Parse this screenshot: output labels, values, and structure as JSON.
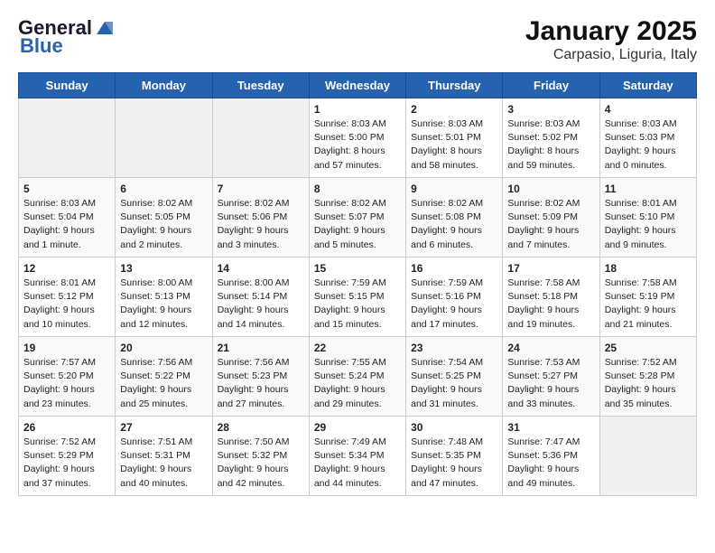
{
  "header": {
    "logo_general": "General",
    "logo_blue": "Blue",
    "title": "January 2025",
    "subtitle": "Carpasio, Liguria, Italy"
  },
  "weekdays": [
    "Sunday",
    "Monday",
    "Tuesday",
    "Wednesday",
    "Thursday",
    "Friday",
    "Saturday"
  ],
  "weeks": [
    [
      {
        "day": "",
        "info": "",
        "empty": true
      },
      {
        "day": "",
        "info": "",
        "empty": true
      },
      {
        "day": "",
        "info": "",
        "empty": true
      },
      {
        "day": "1",
        "info": "Sunrise: 8:03 AM\nSunset: 5:00 PM\nDaylight: 8 hours and 57 minutes.",
        "empty": false
      },
      {
        "day": "2",
        "info": "Sunrise: 8:03 AM\nSunset: 5:01 PM\nDaylight: 8 hours and 58 minutes.",
        "empty": false
      },
      {
        "day": "3",
        "info": "Sunrise: 8:03 AM\nSunset: 5:02 PM\nDaylight: 8 hours and 59 minutes.",
        "empty": false
      },
      {
        "day": "4",
        "info": "Sunrise: 8:03 AM\nSunset: 5:03 PM\nDaylight: 9 hours and 0 minutes.",
        "empty": false
      }
    ],
    [
      {
        "day": "5",
        "info": "Sunrise: 8:03 AM\nSunset: 5:04 PM\nDaylight: 9 hours and 1 minute.",
        "empty": false
      },
      {
        "day": "6",
        "info": "Sunrise: 8:02 AM\nSunset: 5:05 PM\nDaylight: 9 hours and 2 minutes.",
        "empty": false
      },
      {
        "day": "7",
        "info": "Sunrise: 8:02 AM\nSunset: 5:06 PM\nDaylight: 9 hours and 3 minutes.",
        "empty": false
      },
      {
        "day": "8",
        "info": "Sunrise: 8:02 AM\nSunset: 5:07 PM\nDaylight: 9 hours and 5 minutes.",
        "empty": false
      },
      {
        "day": "9",
        "info": "Sunrise: 8:02 AM\nSunset: 5:08 PM\nDaylight: 9 hours and 6 minutes.",
        "empty": false
      },
      {
        "day": "10",
        "info": "Sunrise: 8:02 AM\nSunset: 5:09 PM\nDaylight: 9 hours and 7 minutes.",
        "empty": false
      },
      {
        "day": "11",
        "info": "Sunrise: 8:01 AM\nSunset: 5:10 PM\nDaylight: 9 hours and 9 minutes.",
        "empty": false
      }
    ],
    [
      {
        "day": "12",
        "info": "Sunrise: 8:01 AM\nSunset: 5:12 PM\nDaylight: 9 hours and 10 minutes.",
        "empty": false
      },
      {
        "day": "13",
        "info": "Sunrise: 8:00 AM\nSunset: 5:13 PM\nDaylight: 9 hours and 12 minutes.",
        "empty": false
      },
      {
        "day": "14",
        "info": "Sunrise: 8:00 AM\nSunset: 5:14 PM\nDaylight: 9 hours and 14 minutes.",
        "empty": false
      },
      {
        "day": "15",
        "info": "Sunrise: 7:59 AM\nSunset: 5:15 PM\nDaylight: 9 hours and 15 minutes.",
        "empty": false
      },
      {
        "day": "16",
        "info": "Sunrise: 7:59 AM\nSunset: 5:16 PM\nDaylight: 9 hours and 17 minutes.",
        "empty": false
      },
      {
        "day": "17",
        "info": "Sunrise: 7:58 AM\nSunset: 5:18 PM\nDaylight: 9 hours and 19 minutes.",
        "empty": false
      },
      {
        "day": "18",
        "info": "Sunrise: 7:58 AM\nSunset: 5:19 PM\nDaylight: 9 hours and 21 minutes.",
        "empty": false
      }
    ],
    [
      {
        "day": "19",
        "info": "Sunrise: 7:57 AM\nSunset: 5:20 PM\nDaylight: 9 hours and 23 minutes.",
        "empty": false
      },
      {
        "day": "20",
        "info": "Sunrise: 7:56 AM\nSunset: 5:22 PM\nDaylight: 9 hours and 25 minutes.",
        "empty": false
      },
      {
        "day": "21",
        "info": "Sunrise: 7:56 AM\nSunset: 5:23 PM\nDaylight: 9 hours and 27 minutes.",
        "empty": false
      },
      {
        "day": "22",
        "info": "Sunrise: 7:55 AM\nSunset: 5:24 PM\nDaylight: 9 hours and 29 minutes.",
        "empty": false
      },
      {
        "day": "23",
        "info": "Sunrise: 7:54 AM\nSunset: 5:25 PM\nDaylight: 9 hours and 31 minutes.",
        "empty": false
      },
      {
        "day": "24",
        "info": "Sunrise: 7:53 AM\nSunset: 5:27 PM\nDaylight: 9 hours and 33 minutes.",
        "empty": false
      },
      {
        "day": "25",
        "info": "Sunrise: 7:52 AM\nSunset: 5:28 PM\nDaylight: 9 hours and 35 minutes.",
        "empty": false
      }
    ],
    [
      {
        "day": "26",
        "info": "Sunrise: 7:52 AM\nSunset: 5:29 PM\nDaylight: 9 hours and 37 minutes.",
        "empty": false
      },
      {
        "day": "27",
        "info": "Sunrise: 7:51 AM\nSunset: 5:31 PM\nDaylight: 9 hours and 40 minutes.",
        "empty": false
      },
      {
        "day": "28",
        "info": "Sunrise: 7:50 AM\nSunset: 5:32 PM\nDaylight: 9 hours and 42 minutes.",
        "empty": false
      },
      {
        "day": "29",
        "info": "Sunrise: 7:49 AM\nSunset: 5:34 PM\nDaylight: 9 hours and 44 minutes.",
        "empty": false
      },
      {
        "day": "30",
        "info": "Sunrise: 7:48 AM\nSunset: 5:35 PM\nDaylight: 9 hours and 47 minutes.",
        "empty": false
      },
      {
        "day": "31",
        "info": "Sunrise: 7:47 AM\nSunset: 5:36 PM\nDaylight: 9 hours and 49 minutes.",
        "empty": false
      },
      {
        "day": "",
        "info": "",
        "empty": true
      }
    ]
  ]
}
